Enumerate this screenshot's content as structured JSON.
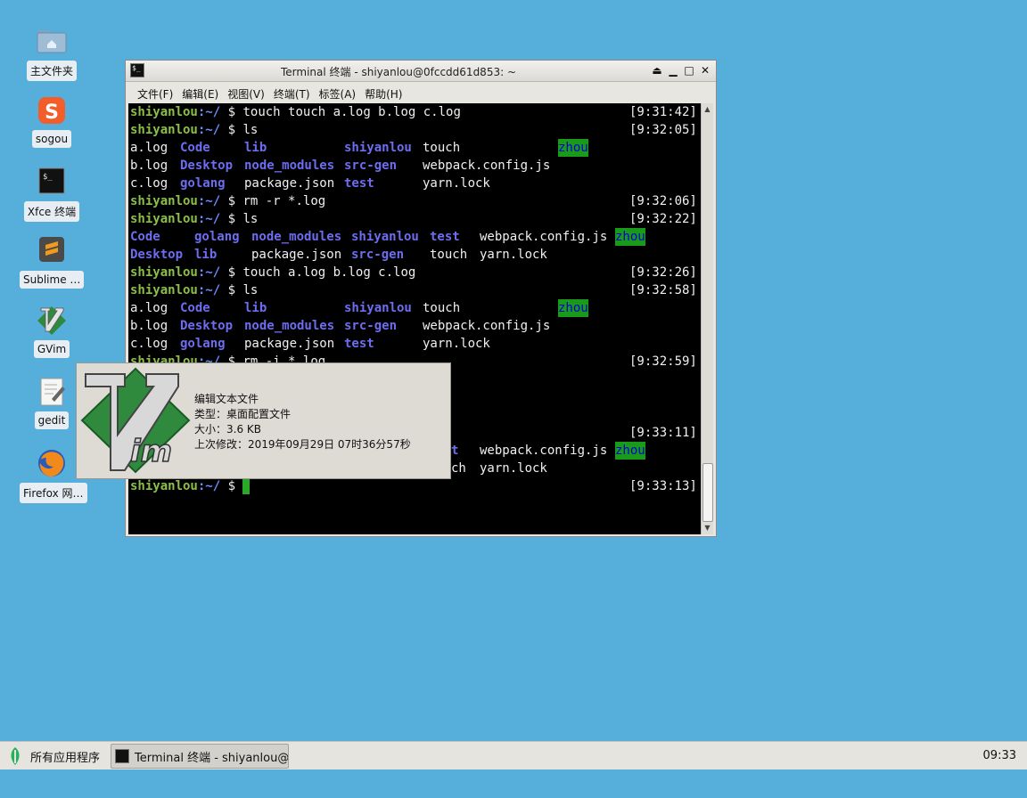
{
  "desktop": {
    "icons": [
      {
        "label": "主文件夹",
        "icon": "home-folder-icon"
      },
      {
        "label": "sogou",
        "icon": "sogou-icon"
      },
      {
        "label": "Xfce 终端",
        "icon": "terminal-icon"
      },
      {
        "label": "Sublime …",
        "icon": "sublime-text-icon"
      },
      {
        "label": "GVim",
        "icon": "gvim-icon"
      },
      {
        "label": "gedit",
        "icon": "gedit-icon"
      },
      {
        "label": "Firefox 网…",
        "icon": "firefox-icon"
      }
    ]
  },
  "terminal": {
    "title": "Terminal 终端 - shiyanlou@0fccdd61d853: ~",
    "menu": [
      "文件(F)",
      "编辑(E)",
      "视图(V)",
      "终端(T)",
      "标签(A)",
      "帮助(H)"
    ],
    "prompt": {
      "user": "shiyanlou",
      "path": ":~/",
      "symbol": "$"
    },
    "commands": [
      {
        "cmd": "touch touch a.log b.log c.log",
        "time": "[9:31:42]"
      },
      {
        "cmd": "ls",
        "time": "[9:32:05]"
      },
      {
        "cmd": "rm -r *.log",
        "time": "[9:32:06]"
      },
      {
        "cmd": "ls",
        "time": "[9:32:22]"
      },
      {
        "cmd": "touch a.log b.log c.log",
        "time": "[9:32:26]"
      },
      {
        "cmd": "ls",
        "time": "[9:32:58]"
      },
      {
        "cmd": "rm -i *.log",
        "time": "[9:32:59]"
      },
      {
        "cmd": "",
        "time": "[9:33:11]"
      },
      {
        "cmd": "",
        "time": "[9:33:13]"
      }
    ],
    "files": {
      "a_log": "a.log",
      "b_log": "b.log",
      "c_log": "c.log",
      "code": "Code",
      "desktop": "Desktop",
      "golang": "golang",
      "lib": "lib",
      "node_modules": "node_modules",
      "package_json": "package.json",
      "shiyanlou": "shiyanlou",
      "src_gen": "src-gen",
      "test": "test",
      "touch": "touch",
      "webpack": "webpack.config.js",
      "yarn": "yarn.lock",
      "zhou": "zhou"
    },
    "partial": {
      "row9": "shiyanlou:~/ $ rm -i *.log",
      "row19a": "t",
      "row20": "ch"
    }
  },
  "tooltip": {
    "name": "编辑文本文件",
    "type": "类型：桌面配置文件",
    "size": "大小：3.6 KB",
    "modified": "上次修改：2019年09月29日 07时36分57秒"
  },
  "taskbar": {
    "apps_label": "所有应用程序",
    "task_label": "Terminal 终端 - shiyanlou@…",
    "clock": "09:33"
  }
}
